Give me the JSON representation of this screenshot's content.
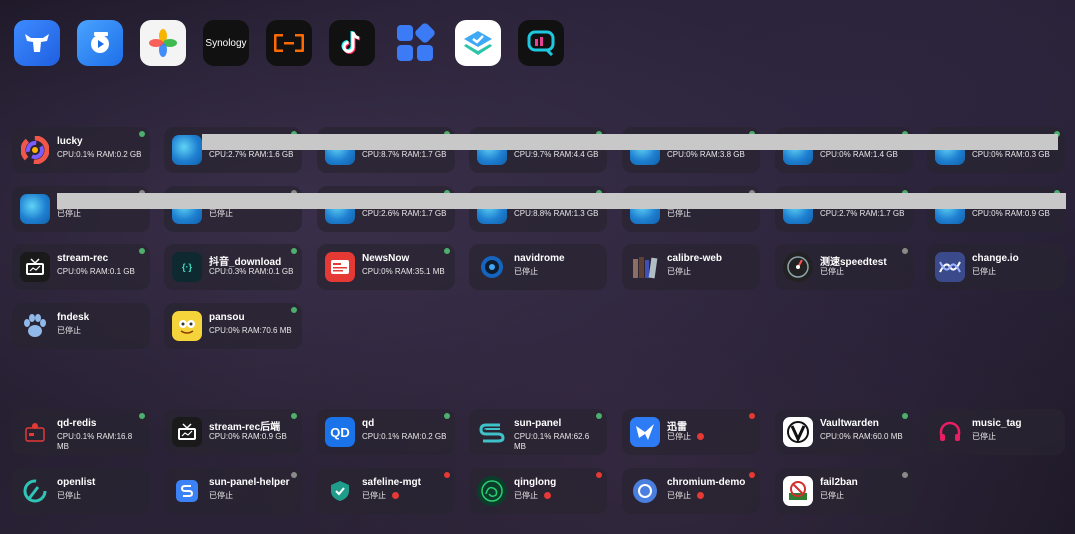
{
  "colors": {
    "dot_green": "#4caf6d",
    "dot_gray": "#8a8a8a",
    "dot_red": "#e53935",
    "redact_bar": "#c8c8c8"
  },
  "dock": [
    {
      "name": "bull-app-icon"
    },
    {
      "name": "video-app-icon"
    },
    {
      "name": "photos-app-icon"
    },
    {
      "name": "synology-app-icon",
      "label": "Synology"
    },
    {
      "name": "aliyun-app-icon"
    },
    {
      "name": "tiktok-app-icon"
    },
    {
      "name": "apps-grid-icon"
    },
    {
      "name": "layers-app-icon"
    },
    {
      "name": "monitor-app-icon"
    }
  ],
  "cards": {
    "r1c1": {
      "name": "lucky",
      "status": "CPU:0.1% RAM:0.2 GB"
    },
    "r1c2": {
      "status": "CPU:2.7% RAM:1.6 GB"
    },
    "r1c3": {
      "status": "CPU:8.7% RAM:1.7 GB"
    },
    "r1c4": {
      "status": "CPU:9.7% RAM:4.4 GB"
    },
    "r1c5": {
      "status": "CPU:0% RAM:3.8 GB"
    },
    "r1c6": {
      "status": "CPU:0% RAM:1.4 GB"
    },
    "r1c7": {
      "status": "CPU:0% RAM:0.3 GB"
    },
    "r2c1": {
      "status": "已停止"
    },
    "r2c2": {
      "status": "已停止"
    },
    "r2c3": {
      "status": "CPU:2.6% RAM:1.7 GB"
    },
    "r2c4": {
      "status": "CPU:8.8% RAM:1.3 GB"
    },
    "r2c5": {
      "status": "已停止"
    },
    "r2c6": {
      "status": "CPU:2.7% RAM:1.7 GB"
    },
    "r2c7": {
      "status": "CPU:0% RAM:0.9 GB"
    },
    "r3c1": {
      "name": "stream-rec",
      "status": "CPU:0% RAM:0.1 GB"
    },
    "r3c2": {
      "name": "抖音_download",
      "status": "CPU:0.3% RAM:0.1 GB"
    },
    "r3c3": {
      "name": "NewsNow",
      "status": "CPU:0% RAM:35.1 MB"
    },
    "r3c4": {
      "name": "navidrome",
      "status": "已停止"
    },
    "r3c5": {
      "name": "calibre-web",
      "status": "已停止"
    },
    "r3c6": {
      "name": "测速speedtest",
      "status": "已停止"
    },
    "r3c7": {
      "name": "change.io",
      "status": "已停止"
    },
    "r4c1": {
      "name": "fndesk",
      "status": "已停止"
    },
    "r4c2": {
      "name": "pansou",
      "status": "CPU:0% RAM:70.6 MB"
    },
    "r5c1": {
      "name": "qd-redis",
      "status": "CPU:0.1% RAM:16.8 MB"
    },
    "r5c2": {
      "name": "stream-rec后端",
      "status": "CPU:0% RAM:0.9 GB"
    },
    "r5c3": {
      "name": "qd",
      "status": "CPU:0.1% RAM:0.2 GB",
      "icon_text": "QD"
    },
    "r5c4": {
      "name": "sun-panel",
      "status": "CPU:0.1% RAM:62.6 MB"
    },
    "r5c5": {
      "name": "迅雷",
      "status": "已停止"
    },
    "r5c6": {
      "name": "Vaultwarden",
      "status": "CPU:0% RAM:60.0 MB"
    },
    "r5c7": {
      "name": "music_tag",
      "status": "已停止"
    },
    "r6c1": {
      "name": "openlist",
      "status": "已停止"
    },
    "r6c2": {
      "name": "sun-panel-helper",
      "status": "已停止"
    },
    "r6c3": {
      "name": "safeline-mgt",
      "status": "已停止"
    },
    "r6c4": {
      "name": "qinglong",
      "status": "已停止"
    },
    "r6c5": {
      "name": "chromium-demo",
      "status": "已停止"
    },
    "r6c6": {
      "name": "fail2ban",
      "status": "已停止"
    }
  }
}
